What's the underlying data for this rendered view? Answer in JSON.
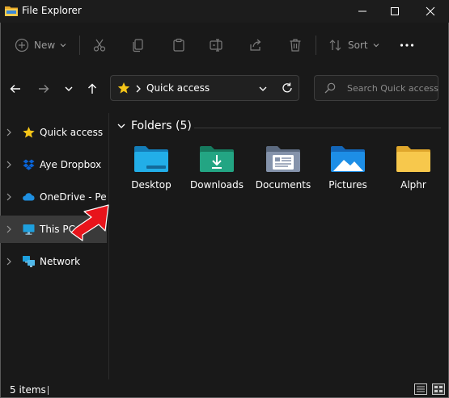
{
  "window": {
    "title": "File Explorer"
  },
  "toolbar": {
    "new_label": "New",
    "sort_label": "Sort"
  },
  "address": {
    "path": "Quick access"
  },
  "search": {
    "placeholder": "Search Quick access"
  },
  "sidebar": {
    "items": [
      {
        "label": "Quick access",
        "icon": "star-icon"
      },
      {
        "label": "Aye Dropbox",
        "icon": "dropbox-icon"
      },
      {
        "label": "OneDrive - Pers",
        "icon": "onedrive-cloud-icon"
      },
      {
        "label": "This PC",
        "icon": "monitor-icon",
        "selected": true
      },
      {
        "label": "Network",
        "icon": "network-icon"
      }
    ]
  },
  "main": {
    "section_title": "Folders (5)",
    "folders": [
      {
        "label": "Desktop",
        "icon": "desktop-folder-icon",
        "color": "#1ea2e0"
      },
      {
        "label": "Downloads",
        "icon": "downloads-folder-icon",
        "color": "#1f9e7a"
      },
      {
        "label": "Documents",
        "icon": "documents-folder-icon",
        "color": "#7f8ea8"
      },
      {
        "label": "Pictures",
        "icon": "pictures-folder-icon",
        "color": "#1e90e0"
      },
      {
        "label": "Alphr",
        "icon": "folder-icon",
        "color": "#f4c447"
      }
    ]
  },
  "status": {
    "items_text": "5 items"
  },
  "colors": {
    "background": "#191919",
    "selected": "#3a3a3a",
    "accent_red": "#e8141b"
  }
}
